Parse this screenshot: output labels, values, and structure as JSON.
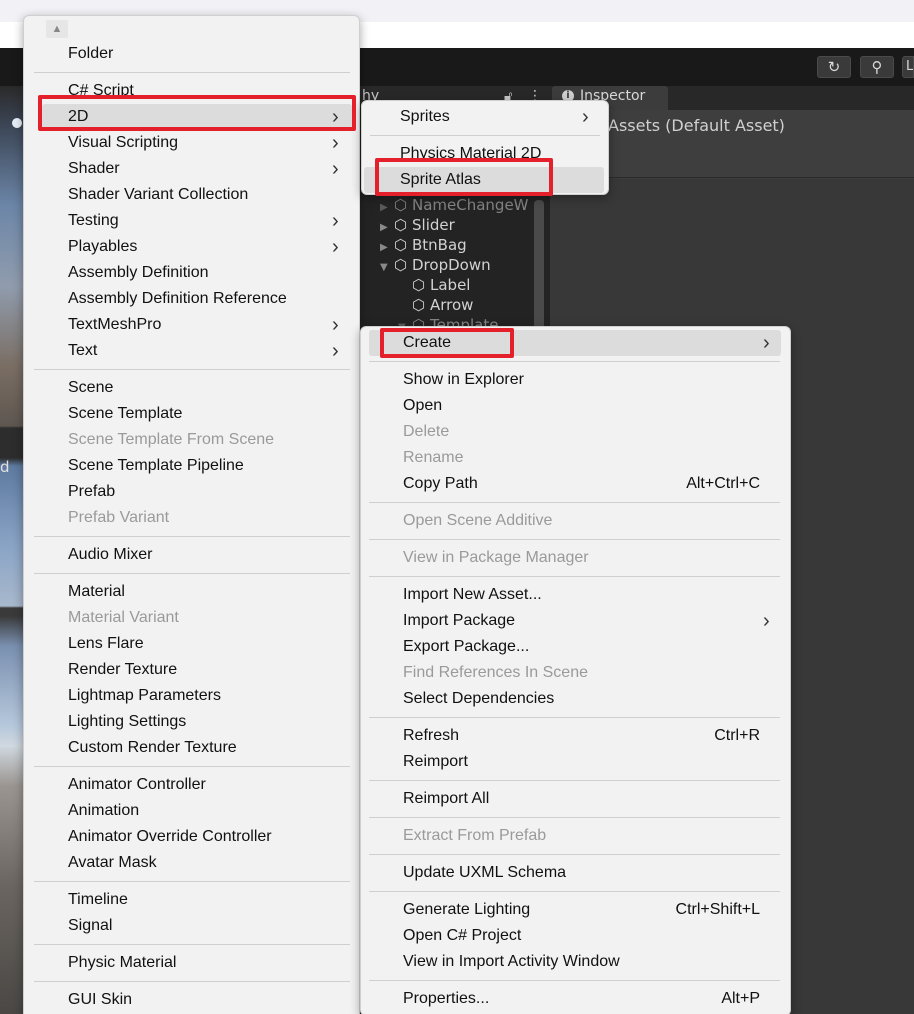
{
  "toolbar": {
    "history_icon": "history-icon",
    "search_icon": "search-icon",
    "layout_fragment": "L"
  },
  "scene_left_label": "d",
  "hierarchy": {
    "tab_fragment": "hy",
    "lock_icon": "lock-icon",
    "kebab_icon": "kebab-icon",
    "items": [
      {
        "label": "NameChangeW",
        "expanded": false,
        "dim": true
      },
      {
        "label": "Slider",
        "expanded": false,
        "dim": false
      },
      {
        "label": "BtnBag",
        "expanded": false,
        "dim": false
      },
      {
        "label": "DropDown",
        "expanded": true,
        "dim": false
      },
      {
        "label": "Label",
        "expanded": null,
        "dim": false
      },
      {
        "label": "Arrow",
        "expanded": null,
        "dim": false
      },
      {
        "label": "Template",
        "expanded": true,
        "dim": true
      }
    ]
  },
  "inspector": {
    "tab_label": "Inspector",
    "tab_icon": "info-icon",
    "title": "Assets (Default Asset)"
  },
  "create_menu": {
    "scroll_up_icon": "scroll-up-icon",
    "items": [
      {
        "label": "Folder"
      },
      {
        "separator": true
      },
      {
        "label": "C# Script"
      },
      {
        "label": "2D",
        "submenu": true,
        "highlighted": true
      },
      {
        "label": "Visual Scripting",
        "submenu": true
      },
      {
        "label": "Shader",
        "submenu": true
      },
      {
        "label": "Shader Variant Collection"
      },
      {
        "label": "Testing",
        "submenu": true
      },
      {
        "label": "Playables",
        "submenu": true
      },
      {
        "label": "Assembly Definition"
      },
      {
        "label": "Assembly Definition Reference"
      },
      {
        "label": "TextMeshPro",
        "submenu": true
      },
      {
        "label": "Text",
        "submenu": true
      },
      {
        "separator": true
      },
      {
        "label": "Scene"
      },
      {
        "label": "Scene Template"
      },
      {
        "label": "Scene Template From Scene",
        "disabled": true
      },
      {
        "label": "Scene Template Pipeline"
      },
      {
        "label": "Prefab"
      },
      {
        "label": "Prefab Variant",
        "disabled": true
      },
      {
        "separator": true
      },
      {
        "label": "Audio Mixer"
      },
      {
        "separator": true
      },
      {
        "label": "Material"
      },
      {
        "label": "Material Variant",
        "disabled": true
      },
      {
        "label": "Lens Flare"
      },
      {
        "label": "Render Texture"
      },
      {
        "label": "Lightmap Parameters"
      },
      {
        "label": "Lighting Settings"
      },
      {
        "label": "Custom Render Texture"
      },
      {
        "separator": true
      },
      {
        "label": "Animator Controller"
      },
      {
        "label": "Animation"
      },
      {
        "label": "Animator Override Controller"
      },
      {
        "label": "Avatar Mask"
      },
      {
        "separator": true
      },
      {
        "label": "Timeline"
      },
      {
        "label": "Signal"
      },
      {
        "separator": true
      },
      {
        "label": "Physic Material"
      },
      {
        "separator": true
      },
      {
        "label": "GUI Skin"
      }
    ]
  },
  "submenu_2d": {
    "items": [
      {
        "label": "Sprites",
        "submenu": true
      },
      {
        "separator": true
      },
      {
        "label": "Physics Material 2D"
      },
      {
        "label": "Sprite Atlas",
        "highlighted": true
      }
    ]
  },
  "context_menu": {
    "items": [
      {
        "label": "Create",
        "submenu": true,
        "highlighted": true
      },
      {
        "separator": true
      },
      {
        "label": "Show in Explorer"
      },
      {
        "label": "Open"
      },
      {
        "label": "Delete",
        "disabled": true
      },
      {
        "label": "Rename",
        "disabled": true
      },
      {
        "label": "Copy Path",
        "shortcut": "Alt+Ctrl+C"
      },
      {
        "separator": true
      },
      {
        "label": "Open Scene Additive",
        "disabled": true
      },
      {
        "separator": true
      },
      {
        "label": "View in Package Manager",
        "disabled": true
      },
      {
        "separator": true
      },
      {
        "label": "Import New Asset..."
      },
      {
        "label": "Import Package",
        "submenu": true
      },
      {
        "label": "Export Package..."
      },
      {
        "label": "Find References In Scene",
        "disabled": true
      },
      {
        "label": "Select Dependencies"
      },
      {
        "separator": true
      },
      {
        "label": "Refresh",
        "shortcut": "Ctrl+R"
      },
      {
        "label": "Reimport"
      },
      {
        "separator": true
      },
      {
        "label": "Reimport All"
      },
      {
        "separator": true
      },
      {
        "label": "Extract From Prefab",
        "disabled": true
      },
      {
        "separator": true
      },
      {
        "label": "Update UXML Schema"
      },
      {
        "separator": true
      },
      {
        "label": "Generate Lighting",
        "shortcut": "Ctrl+Shift+L"
      },
      {
        "label": "Open C# Project"
      },
      {
        "label": "View in Import Activity Window"
      },
      {
        "separator": true
      },
      {
        "label": "Properties...",
        "shortcut": "Alt+P"
      }
    ]
  },
  "colors": {
    "highlight_box": "#e4202a",
    "menu_bg": "#f2f2f2",
    "disabled_text": "#9a9a9a"
  }
}
